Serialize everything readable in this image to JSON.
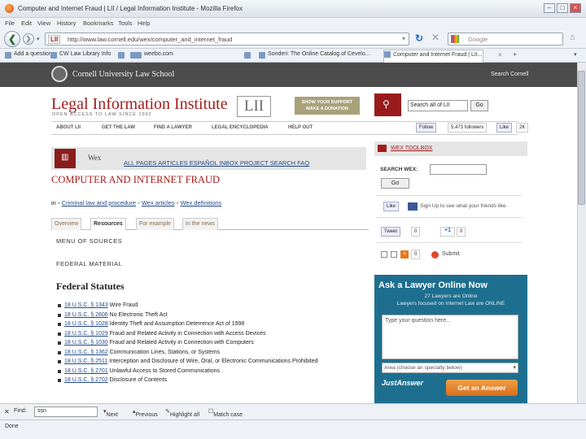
{
  "window": {
    "title": "Computer and Internet Fraud | LII / Legal Information Institute - Mozilla Firefox"
  },
  "menu": [
    "File",
    "Edit",
    "View",
    "History",
    "Bookmarks",
    "Tools",
    "Help"
  ],
  "nav": {
    "url": "http://www.law.cornell.edu/wex/computer_and_internet_fraud",
    "url_badge": "LII",
    "search_engine": "Google"
  },
  "bookmarks": [
    "Add a question",
    "CW Law Library Info",
    "",
    "",
    "weebo.com",
    "",
    "Sonderi: The Online Catalog of Cevelo...",
    "Computer and Internet Fraud | LII..."
  ],
  "cornell": {
    "name": "Cornell University Law School",
    "search_label": "Search Cornell"
  },
  "lii": {
    "title": "Legal Information Institute",
    "box": "LII",
    "subtitle": "OPEN ACCESS TO LAW SINCE 1992",
    "support": [
      "SHOW YOUR SUPPORT",
      "MAKE A DONATION"
    ],
    "search_value": "Search all of LII",
    "go": "Go"
  },
  "topnav": [
    "ABOUT LII",
    "GET THE LAW",
    "FIND A LAWYER",
    "LEGAL ENCYCLOPEDIA",
    "HELP OUT"
  ],
  "social": {
    "follow": "Follow",
    "followers": "5,473 followers",
    "like": "Like",
    "like_count": "2K"
  },
  "wex": {
    "label": "Wex",
    "links": "ALL PAGES  ARTICLES  ESPAÑOL  INBOX  PROJECT  SEARCH  FAQ"
  },
  "page": {
    "title": "COMPUTER AND INTERNET FRAUD"
  },
  "crumbs": {
    "prefix": "in",
    "items": [
      "Criminal law and procedure",
      "Wex articles",
      "Wex definitions"
    ]
  },
  "tabs": [
    "Overview",
    "Resources",
    "For example",
    "In the news"
  ],
  "content": {
    "menu_heading": "MENU OF SOURCES",
    "federal_material": "FEDERAL MATERIAL",
    "federal_statutes": "Federal Statutes",
    "statutes": [
      {
        "cite": "18 U.S.C. § 1343",
        "desc": "Wire Fraud"
      },
      {
        "cite": "18 U.S.C. § 2606",
        "desc": "No Electronic Theft Act"
      },
      {
        "cite": "18 U.S.C. § 1028",
        "desc": "Identity Theft and Assumption Deterrence Act of 1998"
      },
      {
        "cite": "18 U.S.C. § 1029",
        "desc": "Fraud and Related Activity in Connection with Access Devices"
      },
      {
        "cite": "18 U.S.C. § 1030",
        "desc": "Fraud and Related Activity in Connection with Computers"
      },
      {
        "cite": "18 U.S.C. § 1362",
        "desc": "Communication Lines, Stations, or Systems"
      },
      {
        "cite": "18 U.S.C. § 2511",
        "desc": "Interception and Disclosure of Wire, Oral, or Electronic Communications Prohibited"
      },
      {
        "cite": "18 U.S.C. § 2701",
        "desc": "Unlawful Access to Stored Communications"
      },
      {
        "cite": "18 U.S.C. § 2702",
        "desc": "Disclosure of Contents"
      }
    ]
  },
  "sidebar": {
    "toolbox": "WEX TOOLBOX",
    "search_label": "SEARCH WEX:",
    "go": "Go",
    "like": "Like",
    "like_text": "Sign Up to see what your friends like.",
    "tweet": "Tweet",
    "tweet_count": "0",
    "plus_count": "0",
    "share_count": "0",
    "submit": "Submit"
  },
  "ad": {
    "title": "Ask a Lawyer Online Now",
    "sub1": "27 Lawyers are Online",
    "sub2": "Lawyers focused on Internet Law are ONLINE",
    "placeholder": "Type your question here...",
    "select": "Area (choose an specialty below)",
    "logo": "JustAnswer",
    "button": "Get an Answer"
  },
  "findbar": {
    "label": "Find:",
    "value": "ssn",
    "next": "Next",
    "previous": "Previous",
    "highlight": "Highlight all",
    "match_case": "Match case"
  },
  "status": "Done"
}
